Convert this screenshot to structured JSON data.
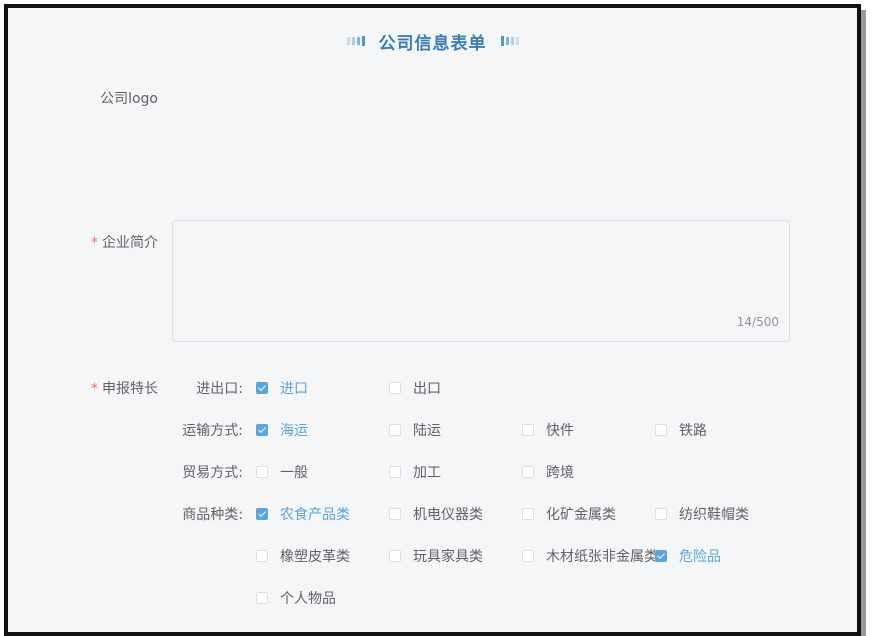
{
  "form": {
    "title": "公司信息表单",
    "logo_label": "公司logo",
    "intro_label": "企业简介",
    "intro_counter": "14/500",
    "specialty_label": "申报特长",
    "required_mark": "*"
  },
  "specialties": {
    "import_export": {
      "label": "进出口:",
      "options": [
        {
          "label": "进口",
          "checked": true
        },
        {
          "label": "出口",
          "checked": false
        }
      ]
    },
    "transport": {
      "label": "运输方式:",
      "options": [
        {
          "label": "海运",
          "checked": true
        },
        {
          "label": "陆运",
          "checked": false
        },
        {
          "label": "快件",
          "checked": false
        },
        {
          "label": "铁路",
          "checked": false
        }
      ]
    },
    "trade": {
      "label": "贸易方式:",
      "options": [
        {
          "label": "一般",
          "checked": false
        },
        {
          "label": "加工",
          "checked": false
        },
        {
          "label": "跨境",
          "checked": false
        }
      ]
    },
    "goods": {
      "label": "商品种类:",
      "options": [
        {
          "label": "农食产品类",
          "checked": true
        },
        {
          "label": "机电仪器类",
          "checked": false
        },
        {
          "label": "化矿金属类",
          "checked": false
        },
        {
          "label": "纺织鞋帽类",
          "checked": false
        },
        {
          "label": "橡塑皮革类",
          "checked": false
        },
        {
          "label": "玩具家具类",
          "checked": false
        },
        {
          "label": "木材纸张非金属类",
          "checked": false
        },
        {
          "label": "危险品",
          "checked": true
        },
        {
          "label": "个人物品",
          "checked": false
        }
      ]
    }
  },
  "colors": {
    "accent": "#5ba4dc",
    "title": "#3a7db5",
    "required": "#f56c6c",
    "label": "#606266"
  }
}
